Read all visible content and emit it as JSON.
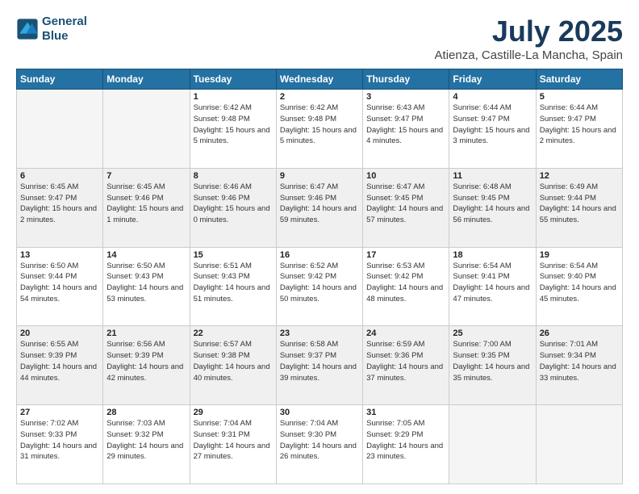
{
  "logo": {
    "line1": "General",
    "line2": "Blue"
  },
  "title": "July 2025",
  "location": "Atienza, Castille-La Mancha, Spain",
  "weekdays": [
    "Sunday",
    "Monday",
    "Tuesday",
    "Wednesday",
    "Thursday",
    "Friday",
    "Saturday"
  ],
  "weeks": [
    [
      {
        "day": "",
        "sunrise": "",
        "sunset": "",
        "daylight": "",
        "empty": true
      },
      {
        "day": "",
        "sunrise": "",
        "sunset": "",
        "daylight": "",
        "empty": true
      },
      {
        "day": "1",
        "sunrise": "Sunrise: 6:42 AM",
        "sunset": "Sunset: 9:48 PM",
        "daylight": "Daylight: 15 hours and 5 minutes."
      },
      {
        "day": "2",
        "sunrise": "Sunrise: 6:42 AM",
        "sunset": "Sunset: 9:48 PM",
        "daylight": "Daylight: 15 hours and 5 minutes."
      },
      {
        "day": "3",
        "sunrise": "Sunrise: 6:43 AM",
        "sunset": "Sunset: 9:47 PM",
        "daylight": "Daylight: 15 hours and 4 minutes."
      },
      {
        "day": "4",
        "sunrise": "Sunrise: 6:44 AM",
        "sunset": "Sunset: 9:47 PM",
        "daylight": "Daylight: 15 hours and 3 minutes."
      },
      {
        "day": "5",
        "sunrise": "Sunrise: 6:44 AM",
        "sunset": "Sunset: 9:47 PM",
        "daylight": "Daylight: 15 hours and 2 minutes."
      }
    ],
    [
      {
        "day": "6",
        "sunrise": "Sunrise: 6:45 AM",
        "sunset": "Sunset: 9:47 PM",
        "daylight": "Daylight: 15 hours and 2 minutes."
      },
      {
        "day": "7",
        "sunrise": "Sunrise: 6:45 AM",
        "sunset": "Sunset: 9:46 PM",
        "daylight": "Daylight: 15 hours and 1 minute."
      },
      {
        "day": "8",
        "sunrise": "Sunrise: 6:46 AM",
        "sunset": "Sunset: 9:46 PM",
        "daylight": "Daylight: 15 hours and 0 minutes."
      },
      {
        "day": "9",
        "sunrise": "Sunrise: 6:47 AM",
        "sunset": "Sunset: 9:46 PM",
        "daylight": "Daylight: 14 hours and 59 minutes."
      },
      {
        "day": "10",
        "sunrise": "Sunrise: 6:47 AM",
        "sunset": "Sunset: 9:45 PM",
        "daylight": "Daylight: 14 hours and 57 minutes."
      },
      {
        "day": "11",
        "sunrise": "Sunrise: 6:48 AM",
        "sunset": "Sunset: 9:45 PM",
        "daylight": "Daylight: 14 hours and 56 minutes."
      },
      {
        "day": "12",
        "sunrise": "Sunrise: 6:49 AM",
        "sunset": "Sunset: 9:44 PM",
        "daylight": "Daylight: 14 hours and 55 minutes."
      }
    ],
    [
      {
        "day": "13",
        "sunrise": "Sunrise: 6:50 AM",
        "sunset": "Sunset: 9:44 PM",
        "daylight": "Daylight: 14 hours and 54 minutes."
      },
      {
        "day": "14",
        "sunrise": "Sunrise: 6:50 AM",
        "sunset": "Sunset: 9:43 PM",
        "daylight": "Daylight: 14 hours and 53 minutes."
      },
      {
        "day": "15",
        "sunrise": "Sunrise: 6:51 AM",
        "sunset": "Sunset: 9:43 PM",
        "daylight": "Daylight: 14 hours and 51 minutes."
      },
      {
        "day": "16",
        "sunrise": "Sunrise: 6:52 AM",
        "sunset": "Sunset: 9:42 PM",
        "daylight": "Daylight: 14 hours and 50 minutes."
      },
      {
        "day": "17",
        "sunrise": "Sunrise: 6:53 AM",
        "sunset": "Sunset: 9:42 PM",
        "daylight": "Daylight: 14 hours and 48 minutes."
      },
      {
        "day": "18",
        "sunrise": "Sunrise: 6:54 AM",
        "sunset": "Sunset: 9:41 PM",
        "daylight": "Daylight: 14 hours and 47 minutes."
      },
      {
        "day": "19",
        "sunrise": "Sunrise: 6:54 AM",
        "sunset": "Sunset: 9:40 PM",
        "daylight": "Daylight: 14 hours and 45 minutes."
      }
    ],
    [
      {
        "day": "20",
        "sunrise": "Sunrise: 6:55 AM",
        "sunset": "Sunset: 9:39 PM",
        "daylight": "Daylight: 14 hours and 44 minutes."
      },
      {
        "day": "21",
        "sunrise": "Sunrise: 6:56 AM",
        "sunset": "Sunset: 9:39 PM",
        "daylight": "Daylight: 14 hours and 42 minutes."
      },
      {
        "day": "22",
        "sunrise": "Sunrise: 6:57 AM",
        "sunset": "Sunset: 9:38 PM",
        "daylight": "Daylight: 14 hours and 40 minutes."
      },
      {
        "day": "23",
        "sunrise": "Sunrise: 6:58 AM",
        "sunset": "Sunset: 9:37 PM",
        "daylight": "Daylight: 14 hours and 39 minutes."
      },
      {
        "day": "24",
        "sunrise": "Sunrise: 6:59 AM",
        "sunset": "Sunset: 9:36 PM",
        "daylight": "Daylight: 14 hours and 37 minutes."
      },
      {
        "day": "25",
        "sunrise": "Sunrise: 7:00 AM",
        "sunset": "Sunset: 9:35 PM",
        "daylight": "Daylight: 14 hours and 35 minutes."
      },
      {
        "day": "26",
        "sunrise": "Sunrise: 7:01 AM",
        "sunset": "Sunset: 9:34 PM",
        "daylight": "Daylight: 14 hours and 33 minutes."
      }
    ],
    [
      {
        "day": "27",
        "sunrise": "Sunrise: 7:02 AM",
        "sunset": "Sunset: 9:33 PM",
        "daylight": "Daylight: 14 hours and 31 minutes."
      },
      {
        "day": "28",
        "sunrise": "Sunrise: 7:03 AM",
        "sunset": "Sunset: 9:32 PM",
        "daylight": "Daylight: 14 hours and 29 minutes."
      },
      {
        "day": "29",
        "sunrise": "Sunrise: 7:04 AM",
        "sunset": "Sunset: 9:31 PM",
        "daylight": "Daylight: 14 hours and 27 minutes."
      },
      {
        "day": "30",
        "sunrise": "Sunrise: 7:04 AM",
        "sunset": "Sunset: 9:30 PM",
        "daylight": "Daylight: 14 hours and 26 minutes."
      },
      {
        "day": "31",
        "sunrise": "Sunrise: 7:05 AM",
        "sunset": "Sunset: 9:29 PM",
        "daylight": "Daylight: 14 hours and 23 minutes."
      },
      {
        "day": "",
        "sunrise": "",
        "sunset": "",
        "daylight": "",
        "empty": true
      },
      {
        "day": "",
        "sunrise": "",
        "sunset": "",
        "daylight": "",
        "empty": true
      }
    ]
  ]
}
